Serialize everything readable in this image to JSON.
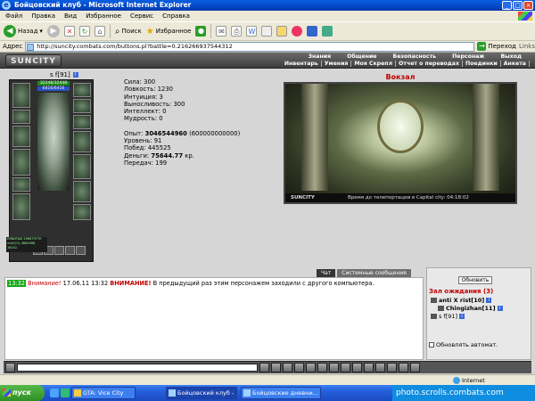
{
  "window": {
    "title": "Бойцовский клуб - Microsoft Internet Explorer"
  },
  "menu": [
    "Файл",
    "Правка",
    "Вид",
    "Избранное",
    "Сервис",
    "Справка"
  ],
  "toolbar": {
    "back": "Назад",
    "search": "Поиск",
    "favorites": "Избранное"
  },
  "address": {
    "label": "Адрес",
    "url": "http://suncity.combats.com/buttons.pl?battle=0.216266937544312",
    "go": "Переход",
    "links": "Links"
  },
  "game": {
    "logo": "SUNCITY",
    "nav_top": [
      "Знания",
      "Общение",
      "Безопасность",
      "Персонаж",
      "Выход"
    ],
    "nav_bottom": [
      "Инвентарь",
      "Умения",
      "Моя Скрепл",
      "Отчет о переводах",
      "Поединки",
      "Анкета"
    ],
    "character": {
      "name": "s f[91]",
      "hp": "32248/32448",
      "mp": "6416/6416",
      "mini_lines": [
        "ИЗБИТЫЕ 29667977К",
        "nicK(21) 3864988",
        "16241"
      ]
    },
    "stats": [
      {
        "label": "Сила:",
        "value": "300"
      },
      {
        "label": "Ловкость:",
        "value": "1230"
      },
      {
        "label": "Интуиция:",
        "value": "3"
      },
      {
        "label": "Выносливость:",
        "value": "300"
      },
      {
        "label": "Интеллект:",
        "value": "0"
      },
      {
        "label": "Мудрость:",
        "value": "0"
      }
    ],
    "exp": {
      "label": "Опыт:",
      "value": "3046544960",
      "extra": "(600000000000)"
    },
    "level": {
      "label": "Уровень:",
      "value": "91"
    },
    "wins": {
      "label": "Побед:",
      "value": "445525"
    },
    "money": {
      "label": "Деньги:",
      "value": "75644.77",
      "unit": "кр."
    },
    "transfers": {
      "label": "Передач:",
      "value": "199"
    },
    "location": {
      "title": "Вокзал",
      "brand": "SUNCITY",
      "teleport_text": "Время до телепортации в Capital city: 04:18:02"
    },
    "chat_tabs": [
      "Чат",
      "Системные сообщения"
    ],
    "chat": {
      "time": "13:32",
      "warning": "Внимание!",
      "date": "17.06.11 13:32",
      "attention": "ВНИМАНИЕ!",
      "text": "В предыдущий раз этим персонажем заходили с другого компьютера."
    },
    "room": {
      "refresh": "Обновить",
      "title": "Зал ожидания (3)",
      "players": [
        "anti X rist[10]",
        "Chingizhan[11]",
        "s f[91]"
      ],
      "auto_label": "Обновлять автомат."
    }
  },
  "statusbar": {
    "zone": "Internet"
  },
  "taskbar": {
    "start": "пуск",
    "tasks": [
      "GTA: Vice City",
      "Бойцовский клуб - M...",
      "Бойцовские дневни..."
    ],
    "tray_text": "photo.scrolls.combats.com"
  }
}
